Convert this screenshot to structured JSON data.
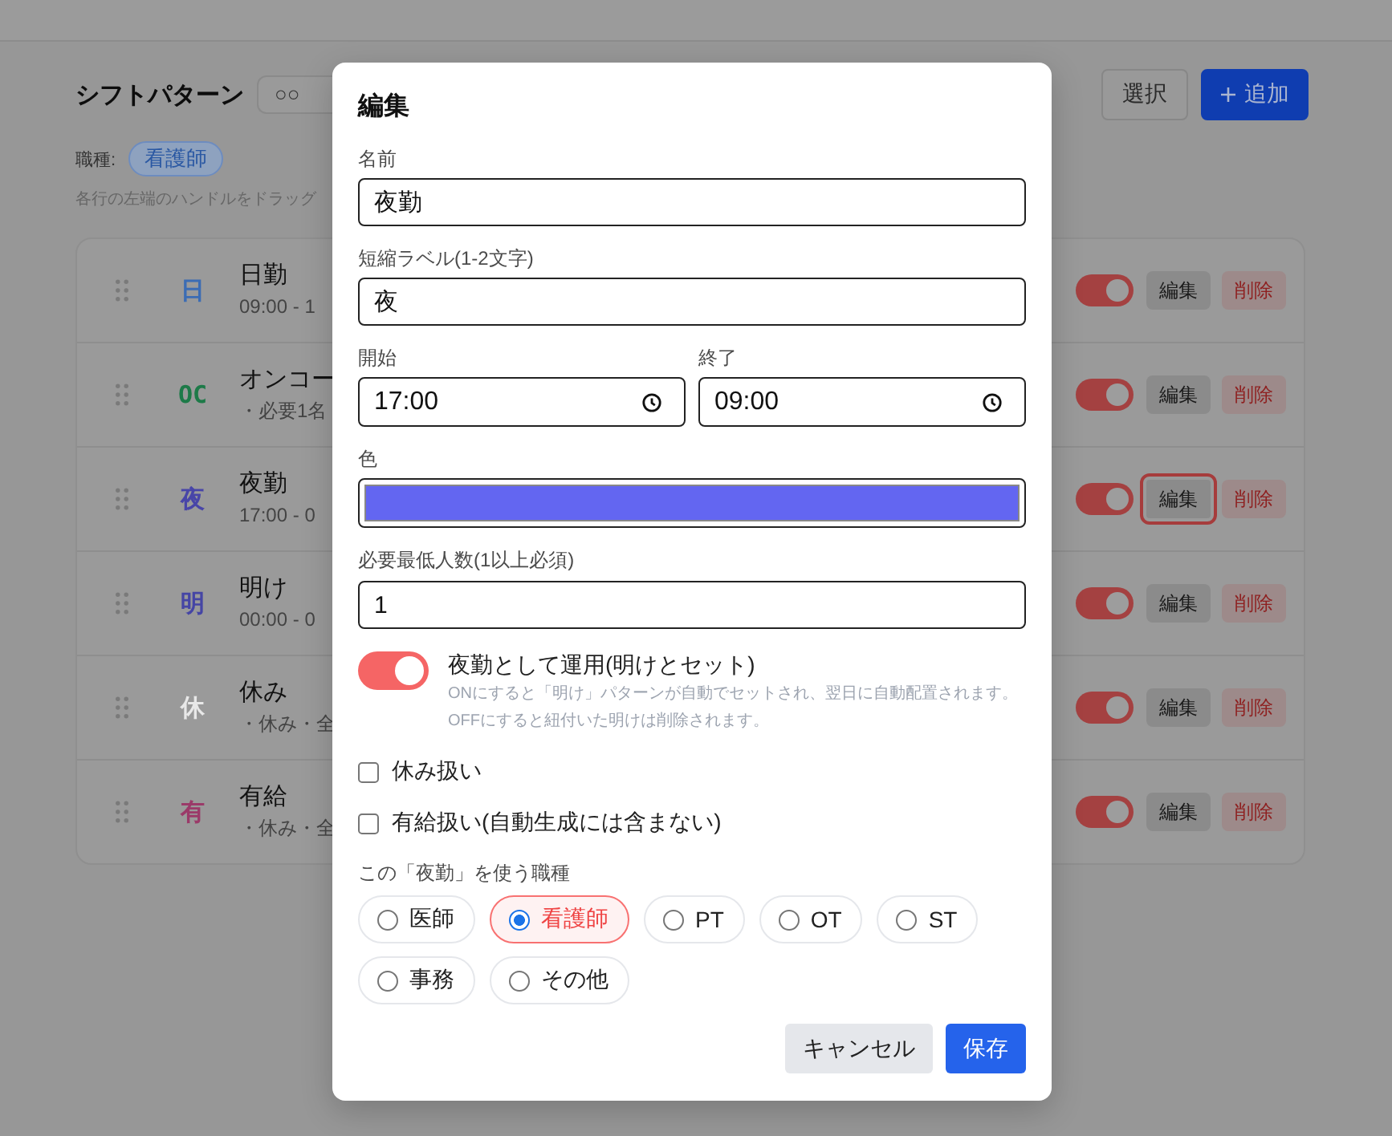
{
  "page": {
    "title": "シフトパターン",
    "facility": "○○",
    "actions": [
      {
        "label": "選択",
        "kind": "outline"
      },
      {
        "label": "追加",
        "kind": "primary"
      }
    ],
    "role_label": "職種:",
    "role_chip": "看護師",
    "hint": "各行の左端のハンドルをドラッグ"
  },
  "patterns": [
    {
      "short": "日",
      "color": "#3b6cb4",
      "name": "日勤",
      "detail": "09:00 - 1",
      "enabled": true,
      "edit_label": "編集",
      "edit_focused": false,
      "delete_label": "削除"
    },
    {
      "short": "OC",
      "color": "#1d7a48",
      "name": "オンコー",
      "detail": "・必要1名",
      "enabled": true,
      "edit_label": "編集",
      "edit_focused": false,
      "delete_label": "削除"
    },
    {
      "short": "夜",
      "color": "#4845a8",
      "name": "夜勤",
      "detail": "17:00 - 0",
      "enabled": true,
      "edit_label": "編集",
      "edit_focused": true,
      "delete_label": "削除"
    },
    {
      "short": "明",
      "color": "#4545a5",
      "name": "明け",
      "detail": "00:00 - 0",
      "enabled": true,
      "edit_label": "編集",
      "edit_focused": false,
      "delete_label": "削除"
    },
    {
      "short": "休",
      "color": "#e8e8e8",
      "name": "休み",
      "detail": "・休み・全",
      "enabled": true,
      "edit_label": "編集",
      "edit_focused": false,
      "delete_label": "削除"
    },
    {
      "short": "有",
      "color": "#9b3a69",
      "name": "有給",
      "detail": "・休み・全",
      "enabled": true,
      "edit_label": "編集",
      "edit_focused": false,
      "delete_label": "削除"
    }
  ],
  "dialog": {
    "title": "編集",
    "name_field": {
      "label": "名前",
      "value": "夜勤"
    },
    "short_field": {
      "label": "短縮ラベル(1-2文字)",
      "value": "夜"
    },
    "start_field": {
      "label": "開始",
      "value": "17:00"
    },
    "end_field": {
      "label": "終了",
      "value": "09:00"
    },
    "color_field": {
      "label": "色",
      "color": "#6366f1"
    },
    "min_staff_field": {
      "label": "必要最低人数(1以上必須)",
      "value": "1"
    },
    "night_toggle": {
      "label": "夜勤として運用(明けとセット)",
      "on": true,
      "help": [
        "ONにすると「明け」パターンが自動でセットされ、翌日に自動配置されます。",
        "OFFにすると紐付いた明けは削除されます。"
      ]
    },
    "checkboxes": [
      {
        "label": "休み扱い",
        "checked": false
      },
      {
        "label": "有給扱い(自動生成には含まない)",
        "checked": false
      }
    ],
    "roles_label": "この「夜勤」を使う職種",
    "roles": [
      {
        "label": "医師",
        "selected": false
      },
      {
        "label": "看護師",
        "selected": true
      },
      {
        "label": "PT",
        "selected": false
      },
      {
        "label": "OT",
        "selected": false
      },
      {
        "label": "ST",
        "selected": false
      },
      {
        "label": "事務",
        "selected": false
      },
      {
        "label": "その他",
        "selected": false
      }
    ],
    "buttons": [
      {
        "label": "キャンセル",
        "kind": "secondary"
      },
      {
        "label": "保存",
        "kind": "primary"
      }
    ]
  }
}
